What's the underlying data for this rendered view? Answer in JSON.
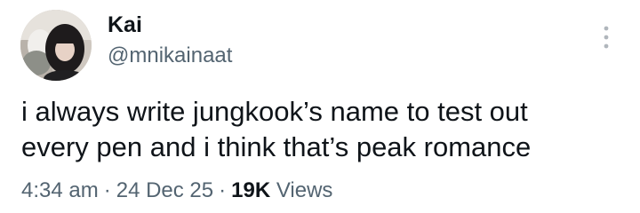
{
  "author": {
    "display_name": "Kai",
    "handle": "@mnikainaat"
  },
  "tweet": {
    "text": "i always write jungkook’s name to test out\nevery pen and i think that’s peak romance"
  },
  "meta": {
    "time": "4:34 am",
    "separator": "·",
    "date": "24 Dec 25",
    "views_count": "19K",
    "views_label": "Views"
  },
  "icons": {
    "more": "more-vertical-icon",
    "avatar": "profile-photo"
  },
  "colors": {
    "primary_text": "#0f1419",
    "secondary_text": "#536471",
    "more_icon": "#b0b6bc"
  }
}
